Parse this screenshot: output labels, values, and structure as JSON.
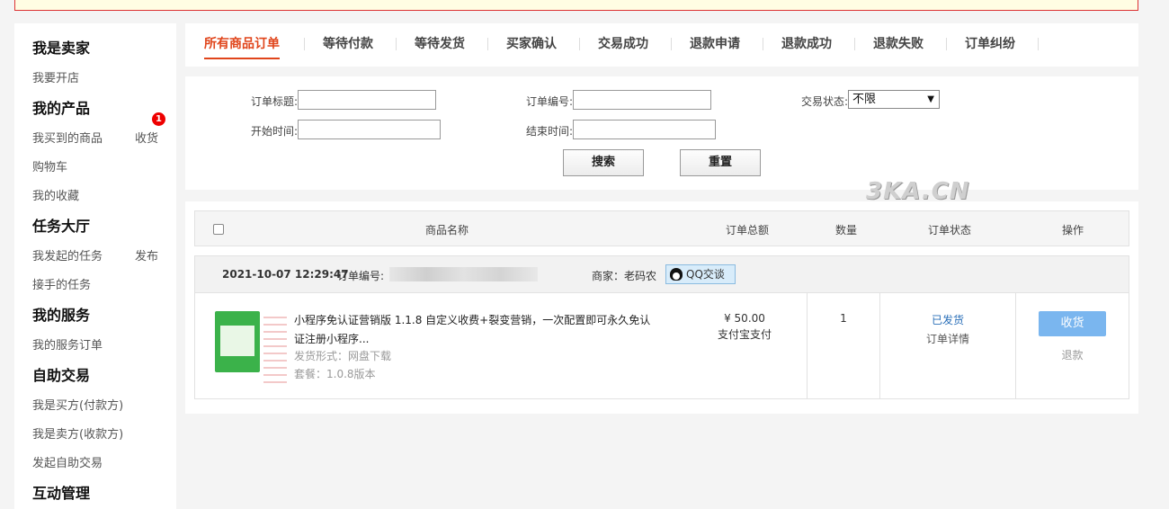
{
  "sidebar": {
    "sections": [
      {
        "title": "我是卖家",
        "items": [
          "我要开店"
        ]
      },
      {
        "title": "我的产品",
        "items": [
          "我买到的商品",
          "购物车",
          "我的收藏"
        ],
        "aside": "收货",
        "badge": "1"
      },
      {
        "title": "任务大厅",
        "items": [
          "我发起的任务",
          "接手的任务"
        ],
        "aside": "发布"
      },
      {
        "title": "我的服务",
        "items": [
          "我的服务订单"
        ]
      },
      {
        "title": "自助交易",
        "items": [
          "我是买方(付款方)",
          "我是卖方(收款方)",
          "发起自助交易"
        ]
      },
      {
        "title": "互动管理",
        "items": []
      }
    ]
  },
  "tabs": [
    "所有商品订单",
    "等待付款",
    "等待发货",
    "买家确认",
    "交易成功",
    "退款申请",
    "退款成功",
    "退款失败",
    "订单纠纷"
  ],
  "search": {
    "title_label": "订单标题:",
    "order_no_label": "订单编号:",
    "status_label": "交易状态:",
    "status_value": "不限",
    "start_label": "开始时间:",
    "end_label": "结束时间:",
    "search_btn": "搜索",
    "reset_btn": "重置"
  },
  "watermark": "3KA.CN",
  "table": {
    "headers": [
      "商品名称",
      "订单总额",
      "数量",
      "订单状态",
      "操作"
    ]
  },
  "order": {
    "datetime": "2021-10-07 12:29:47",
    "order_no_label": "订单编号:",
    "seller_label": "商家：老码农",
    "qq_label": "QQ交谈",
    "product_name": "小程序免认证营销版 1.1.8 自定义收费+裂变营销，一次配置即可永久免认证注册小程序...",
    "delivery": "发货形式：网盘下载",
    "package": "套餐：1.0.8版本",
    "amount": "¥ 50.00",
    "pay_method": "支付宝支付",
    "quantity": "1",
    "status": "已发货",
    "detail_link": "订单详情",
    "receive_btn": "收货",
    "refund_link": "退款"
  }
}
